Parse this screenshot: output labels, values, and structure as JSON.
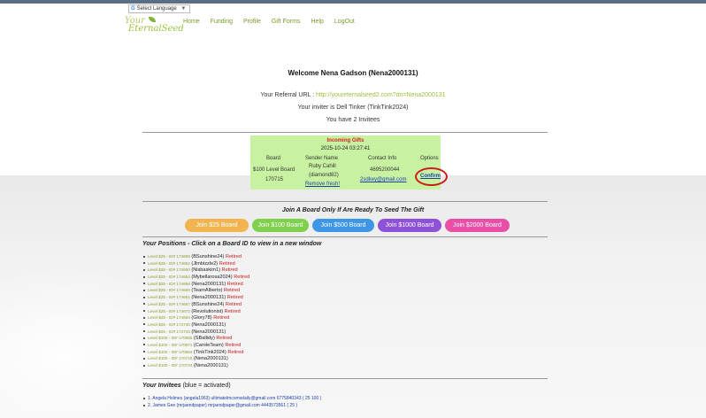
{
  "language": {
    "label": "Select Language",
    "arrow": "▼",
    "icon": "G"
  },
  "logo": {
    "line1": "Your",
    "line2": "EternalSeed"
  },
  "nav": [
    "Home",
    "Funding",
    "Profile",
    "Gift Forms",
    "Help",
    "LogOut"
  ],
  "welcome": "Welcome Nena Gadson (Nena2000131)",
  "referral": {
    "label": "Your Referral URL :",
    "url": "http://youreternalseed2.com?dn=Nena2000131"
  },
  "inviter": "Your inviter is Dell Tinker (TinkTink2024)",
  "invitees_count": "You have 2 Invitees",
  "gifts": {
    "title": "Incoming Gifts",
    "date": "2025-10-24 03:27:41",
    "headers": {
      "board": "Board",
      "sender": "Sender Name",
      "contact": "Contact Info",
      "options": "Options"
    },
    "row": {
      "board_line1": "$100 Level Board",
      "board_line2": "170715",
      "sender_line1": "Ruby Cahill",
      "sender_line2": "(diamond82)",
      "remove": "Remove fresh!",
      "phone": "4695200044",
      "email": "2sdkey@gmail.com",
      "confirm": "Confirm"
    }
  },
  "join_title": "Join A Board Only If Are Ready To Seed The Gift",
  "join_buttons": [
    {
      "label": "Join $25 Board",
      "color": "#f2b450"
    },
    {
      "label": "Join $100 Board",
      "color": "#7fd04c"
    },
    {
      "label": "Join $500 Board",
      "color": "#3e97e6"
    },
    {
      "label": "Join $1000 Board",
      "color": "#8e52d8"
    },
    {
      "label": "Join $2000 Board",
      "color": "#e84fa6"
    }
  ],
  "positions_title": "Your Positions - Click on a Board ID to view in a new window",
  "positions": [
    {
      "level": "Level $25 - ID# 174696",
      "user": "(BSunshine24)",
      "status": "Retired"
    },
    {
      "level": "Level $25 - ID# 174652",
      "user": "(Jlmbizzle2)",
      "status": "Retired"
    },
    {
      "level": "Level $25 - ID# 174650",
      "user": "(Nisbaskim1)",
      "status": "Retired"
    },
    {
      "level": "Level $25 - ID# 174654",
      "user": "(Mybellarosa2024)",
      "status": "Retired"
    },
    {
      "level": "Level $25 - ID# 174658",
      "user": "(Nena2000131)",
      "status": "Retired"
    },
    {
      "level": "Level $25 - ID# 174658",
      "user": "(TeamAlberto)",
      "status": "Retired"
    },
    {
      "level": "Level $25 - ID# 174661",
      "user": "(Nena2000131)",
      "status": "Retired"
    },
    {
      "level": "Level $25 - ID# 174667",
      "user": "(BSunshine24)",
      "status": "Retired"
    },
    {
      "level": "Level $25 - ID# 174673",
      "user": "(Revolutionist)",
      "status": "Retired"
    },
    {
      "level": "Level $25 - ID# 174683",
      "user": "(Glory78)",
      "status": "Retired"
    },
    {
      "level": "Level $25 - ID# 174740",
      "user": "(Nena2000131)",
      "status": ""
    },
    {
      "level": "Level $25 - ID# 174743",
      "user": "(Nena2000131)",
      "status": ""
    },
    {
      "level": "Level $100 - ID# 170665",
      "user": "(SBallidy)",
      "status": "Retired"
    },
    {
      "level": "Level $100 - ID# 170671",
      "user": "(CaroleTeam)",
      "status": "Retired"
    },
    {
      "level": "Level $100 - ID# 170684",
      "user": "(TinkTink2024)",
      "status": "Retired"
    },
    {
      "level": "Level $100 - ID# 170715",
      "user": "(Nena2000131)",
      "status": ""
    },
    {
      "level": "Level $100 - ID# 170734",
      "user": "(Nena2000131)",
      "status": ""
    }
  ],
  "invitees_title": "Your Invitees",
  "invitees_note": "(blue = activated)",
  "invitees": [
    "1. Angela Holmes (angela1963) ultimatelmcomsdaily@gmail.com 6775840343 ( 25 100 )",
    "2. James Gee (mrjaendpaper) mrjaendpaper@gmail.com 4443573561 ( 25 )"
  ]
}
